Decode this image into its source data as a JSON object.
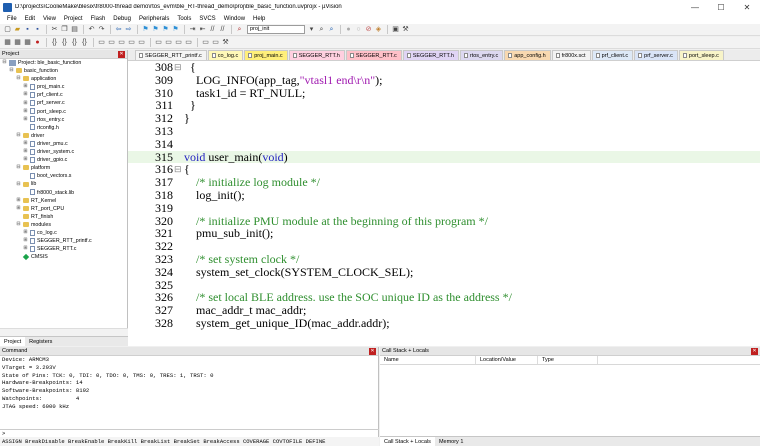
{
  "window": {
    "title": "D:\\projects\\CoolieMake\\blesix\\fr8000-thread demo\\rtos_evm\\ble_RT-thread_demo\\proj\\ble_basic_function.uvprojx - µVision"
  },
  "menu": [
    "File",
    "Edit",
    "View",
    "Project",
    "Flash",
    "Debug",
    "Peripherals",
    "Tools",
    "SVCS",
    "Window",
    "Help"
  ],
  "toolbar": {
    "target_combo": "proj_init",
    "target_select": ""
  },
  "project_panel": {
    "title": "Project",
    "tree": [
      {
        "label": "Project: ble_basic_function",
        "level": 0,
        "kind": "project",
        "toggle": "−"
      },
      {
        "label": "basic_function",
        "level": 1,
        "kind": "folder",
        "toggle": "−"
      },
      {
        "label": "application",
        "level": 2,
        "kind": "folder",
        "toggle": "−"
      },
      {
        "label": "proj_main.c",
        "level": 3,
        "kind": "file",
        "toggle": "+"
      },
      {
        "label": "prf_client.c",
        "level": 3,
        "kind": "file",
        "toggle": "+"
      },
      {
        "label": "prf_server.c",
        "level": 3,
        "kind": "file",
        "toggle": "+"
      },
      {
        "label": "port_sleep.c",
        "level": 3,
        "kind": "file",
        "toggle": "+"
      },
      {
        "label": "rtos_entry.c",
        "level": 3,
        "kind": "file",
        "toggle": "+"
      },
      {
        "label": "rtconfig.h",
        "level": 3,
        "kind": "file",
        "toggle": ""
      },
      {
        "label": "driver",
        "level": 2,
        "kind": "folder",
        "toggle": "−"
      },
      {
        "label": "driver_pmu.c",
        "level": 3,
        "kind": "file",
        "toggle": "+"
      },
      {
        "label": "driver_system.c",
        "level": 3,
        "kind": "file",
        "toggle": "+"
      },
      {
        "label": "driver_gpio.c",
        "level": 3,
        "kind": "file",
        "toggle": "+"
      },
      {
        "label": "platform",
        "level": 2,
        "kind": "folder",
        "toggle": "−"
      },
      {
        "label": "boot_vectors.s",
        "level": 3,
        "kind": "file",
        "toggle": ""
      },
      {
        "label": "lib",
        "level": 2,
        "kind": "folder",
        "toggle": "−"
      },
      {
        "label": "fr8000_stack.lib",
        "level": 3,
        "kind": "file",
        "toggle": ""
      },
      {
        "label": "RT_Kernel",
        "level": 2,
        "kind": "folder",
        "toggle": "+"
      },
      {
        "label": "RT_port_CPU",
        "level": 2,
        "kind": "folder",
        "toggle": "+"
      },
      {
        "label": "RT_finish",
        "level": 2,
        "kind": "folder",
        "toggle": ""
      },
      {
        "label": "modules",
        "level": 2,
        "kind": "folder",
        "toggle": "−"
      },
      {
        "label": "co_log.c",
        "level": 3,
        "kind": "file",
        "toggle": "+"
      },
      {
        "label": "SEGGER_RTT_printf.c",
        "level": 3,
        "kind": "file",
        "toggle": "+"
      },
      {
        "label": "SEGGER_RTT.c",
        "level": 3,
        "kind": "file",
        "toggle": "+"
      },
      {
        "label": "CMSIS",
        "level": 2,
        "kind": "gem",
        "toggle": ""
      }
    ],
    "tabs": [
      "Project",
      "Registers"
    ]
  },
  "editor": {
    "tabs": [
      {
        "label": "SEGGER_RTT_printf.c",
        "color": "#f4f4f4"
      },
      {
        "label": "co_log.c",
        "color": "#fff9b8"
      },
      {
        "label": "proj_main.c",
        "color": "#ffef7a"
      },
      {
        "label": "SEGGER_RTT.h",
        "color": "#ffd0e0"
      },
      {
        "label": "SEGGER_RTT.c",
        "color": "#ffc0c8"
      },
      {
        "label": "SEGGER_RTT.h",
        "color": "#e0d4f5"
      },
      {
        "label": "rtos_entry.c",
        "color": "#dcd8f0"
      },
      {
        "label": "app_config.h",
        "color": "#f8d8b0"
      },
      {
        "label": "fr800x.sct",
        "color": "#f3f3f3"
      },
      {
        "label": "prf_client.c",
        "color": "#dde9f7"
      },
      {
        "label": "prf_server.c",
        "color": "#d9e4f7"
      },
      {
        "label": "port_sleep.c",
        "color": "#f8f4c8"
      }
    ],
    "lines": [
      {
        "num": "308",
        "gutter": "⊟",
        "text": "  {",
        "type": "plain"
      },
      {
        "num": "309",
        "gutter": "",
        "text": "    LOG_INFO(app_tag,",
        "str": "\"vtasl1 end\\r\\n\"",
        "rest": ");",
        "type": "str"
      },
      {
        "num": "310",
        "gutter": "",
        "text": "    task1_id = RT_NULL;",
        "type": "plain"
      },
      {
        "num": "311",
        "gutter": "",
        "text": "  }",
        "type": "plain"
      },
      {
        "num": "312",
        "gutter": "",
        "text": "}",
        "type": "plain"
      },
      {
        "num": "313",
        "gutter": "",
        "text": "",
        "type": "plain"
      },
      {
        "num": "314",
        "gutter": "",
        "text": "",
        "type": "plain"
      },
      {
        "num": "315",
        "gutter": "",
        "kw": "void",
        "text": " user_main(",
        "kw2": "void",
        "rest": ")",
        "type": "kw",
        "highlight": true
      },
      {
        "num": "316",
        "gutter": "⊟",
        "text": "{",
        "type": "plain"
      },
      {
        "num": "317",
        "gutter": "",
        "text": "    /* initialize log module */",
        "type": "comment"
      },
      {
        "num": "318",
        "gutter": "",
        "text": "    log_init();",
        "type": "plain"
      },
      {
        "num": "319",
        "gutter": "",
        "text": "",
        "type": "plain"
      },
      {
        "num": "320",
        "gutter": "",
        "text": "    /* initialize PMU module at the beginning of this program */",
        "type": "comment"
      },
      {
        "num": "321",
        "gutter": "",
        "text": "    pmu_sub_init();",
        "type": "plain"
      },
      {
        "num": "322",
        "gutter": "",
        "text": "",
        "type": "plain"
      },
      {
        "num": "323",
        "gutter": "",
        "text": "    /* set system clock */",
        "type": "comment"
      },
      {
        "num": "324",
        "gutter": "",
        "text": "    system_set_clock(SYSTEM_CLOCK_SEL);",
        "type": "plain"
      },
      {
        "num": "325",
        "gutter": "",
        "text": "",
        "type": "plain"
      },
      {
        "num": "326",
        "gutter": "",
        "text": "    /* set local BLE address. use the SOC unique ID as the address */",
        "type": "comment"
      },
      {
        "num": "327",
        "gutter": "",
        "text": "    mac_addr_t mac_addr;",
        "type": "plain"
      },
      {
        "num": "328",
        "gutter": "",
        "text": "    system_get_unique_ID(mac_addr.addr);",
        "type": "plain"
      }
    ]
  },
  "command_panel": {
    "title": "Command",
    "output": [
      "Device: ARMCM3",
      "VTarget = 3.293V",
      "State of Pins: TCK: 0, TDI: 0, TDO: 0, TMS: 0, TRES: 1, TRST: 0",
      "Hardware-Breakpoints: 14",
      "Software-Breakpoints: 8192",
      "Watchpoints:          4",
      "JTAG speed: 6000 kHz"
    ],
    "prompt": ">",
    "hint": "ASSIGN BreakDisable BreakEnable BreakKill BreakList BreakSet BreakAccess COVERAGE COVTOFILE DEFINE"
  },
  "callstack_panel": {
    "title": "Call Stack + Locals",
    "columns": [
      "Name",
      "Location/Value",
      "Type"
    ],
    "tabs": [
      "Call Stack + Locals",
      "Memory 1"
    ]
  }
}
